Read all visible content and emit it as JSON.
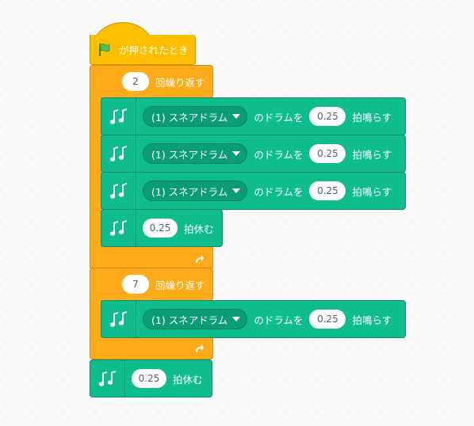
{
  "colors": {
    "event": "#ffbf00",
    "control": "#ffab19",
    "music": "#0fbd8c",
    "background": "#f9f9f9"
  },
  "icons": {
    "flag": "green-flag-icon",
    "music": "music-notes-icon",
    "dropdown": "dropdown-arrow-icon",
    "loop": "loop-arrow-icon"
  },
  "script": {
    "hat_label": "が押されたとき",
    "loop1": {
      "count": "2",
      "label": "回繰り返す",
      "blocks": [
        {
          "drum": "(1) スネアドラム",
          "mid": "のドラムを",
          "beats": "0.25",
          "end": "拍鳴らす"
        },
        {
          "drum": "(1) スネアドラム",
          "mid": "のドラムを",
          "beats": "0.25",
          "end": "拍鳴らす"
        },
        {
          "drum": "(1) スネアドラム",
          "mid": "のドラムを",
          "beats": "0.25",
          "end": "拍鳴らす"
        }
      ],
      "rest": {
        "beats": "0.25",
        "label": "拍休む"
      }
    },
    "loop2": {
      "count": "7",
      "label": "回繰り返す",
      "blocks": [
        {
          "drum": "(1) スネアドラム",
          "mid": "のドラムを",
          "beats": "0.25",
          "end": "拍鳴らす"
        }
      ]
    },
    "final_rest": {
      "beats": "0.25",
      "label": "拍休む"
    }
  }
}
